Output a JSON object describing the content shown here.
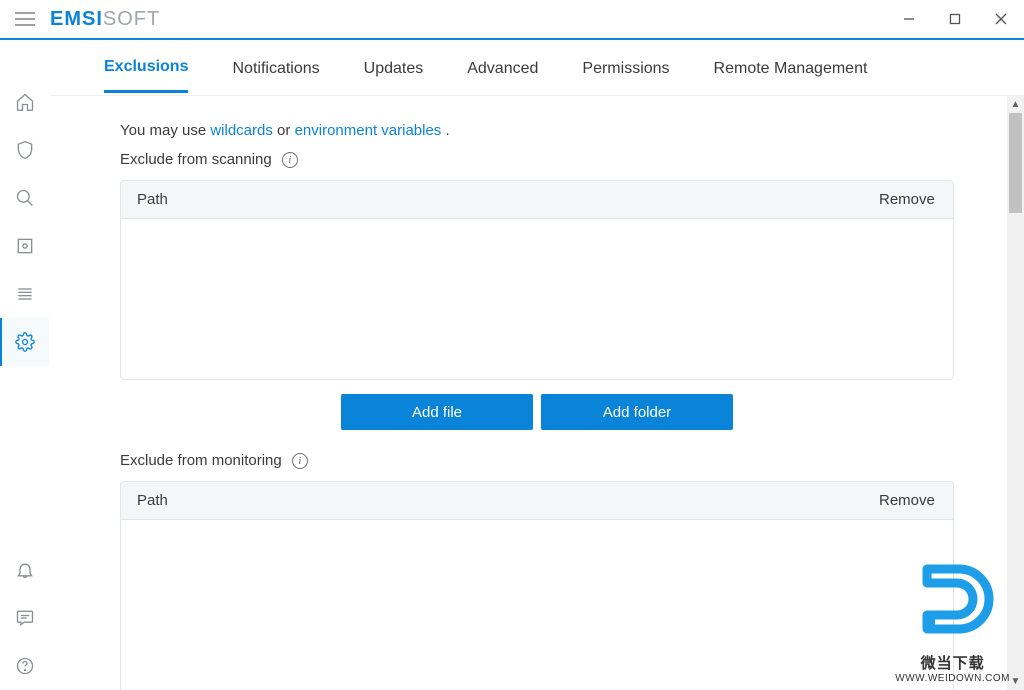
{
  "brand": {
    "bold": "EMSI",
    "light": "SOFT"
  },
  "tabs": {
    "exclusions": "Exclusions",
    "notifications": "Notifications",
    "updates": "Updates",
    "advanced": "Advanced",
    "permissions": "Permissions",
    "remote": "Remote Management"
  },
  "hint": {
    "prefix": "You may use ",
    "link1": "wildcards",
    "mid": " or ",
    "link2": "environment variables",
    "suffix": " ."
  },
  "scanning": {
    "label": "Exclude from scanning",
    "col_path": "Path",
    "col_remove": "Remove"
  },
  "monitoring": {
    "label": "Exclude from monitoring",
    "col_path": "Path",
    "col_remove": "Remove"
  },
  "buttons": {
    "add_file": "Add file",
    "add_folder": "Add folder"
  },
  "watermark": {
    "line1": "微当下载",
    "line2": "WWW.WEIDOWN.COM"
  }
}
